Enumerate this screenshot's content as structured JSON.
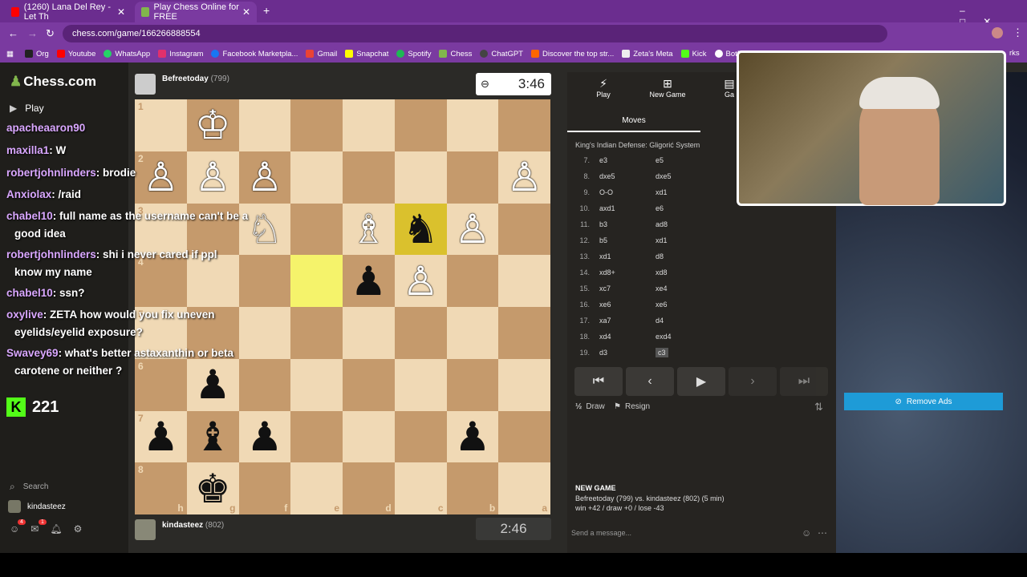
{
  "browser": {
    "tabs": [
      {
        "title": "(1260) Lana Del Rey - Let Th",
        "close": "✕"
      },
      {
        "title": "Play Chess Online for FREE",
        "close": "✕"
      }
    ],
    "new_tab": "+",
    "url": "chess.com/game/166266888554",
    "bookmarks": [
      "Org",
      "Youtube",
      "WhatsApp",
      "Instagram",
      "Facebook Marketpla...",
      "Gmail",
      "Snapchat",
      "Spotify",
      "Chess",
      "ChatGPT",
      "Discover the top str...",
      "Zeta's Meta",
      "Kick",
      "BotRix"
    ],
    "bookmarks_more": "rks"
  },
  "nav": {
    "logo": "Chess.com",
    "play": "Play",
    "search": "Search",
    "username": "kindasteez",
    "badges": [
      "4",
      "1"
    ]
  },
  "top_player": {
    "name": "Befreetoday",
    "rating": "(799)",
    "clock": "3:46"
  },
  "bottom_player": {
    "name": "kindasteez",
    "rating": "(802)",
    "clock": "2:46"
  },
  "board": {
    "ranks": [
      "1",
      "2",
      "3",
      "4",
      "5",
      "6",
      "7",
      "8"
    ],
    "files": [
      "h",
      "g",
      "f",
      "e",
      "d",
      "c",
      "b",
      "a"
    ],
    "squares": [
      [
        "",
        "♔w",
        "",
        "",
        "",
        "",
        "",
        ""
      ],
      [
        "♙w",
        "♙w",
        "♙w",
        "",
        "",
        "",
        "",
        "♙w"
      ],
      [
        "",
        "",
        "♘w",
        "",
        "♗w",
        "♞b",
        "♙w",
        ""
      ],
      [
        "",
        "",
        "",
        "",
        "♟b",
        "♙w",
        "",
        ""
      ],
      [
        "",
        "",
        "",
        "",
        "",
        "",
        "",
        ""
      ],
      [
        "",
        "♟b",
        "",
        "",
        "",
        "",
        "",
        ""
      ],
      [
        "♟b",
        "♝b",
        "♟b",
        "",
        "",
        "",
        "♟b",
        ""
      ],
      [
        "",
        "♚b",
        "",
        "",
        "",
        "",
        "",
        ""
      ]
    ]
  },
  "panel": {
    "tabs": [
      "Play",
      "New Game",
      "Ga"
    ],
    "moves_tab": "Moves",
    "opening": "King's Indian Defense: Gligorić System",
    "moves": [
      {
        "n": "7.",
        "w": "e3",
        "b": "e5"
      },
      {
        "n": "8.",
        "w": "dxe5",
        "b": "dxe5"
      },
      {
        "n": "9.",
        "w": "O-O",
        "b": "xd1"
      },
      {
        "n": "10.",
        "w": "axd1",
        "b": "e6"
      },
      {
        "n": "11.",
        "w": "b3",
        "b": "ad8"
      },
      {
        "n": "12.",
        "w": "b5",
        "b": "xd1"
      },
      {
        "n": "13.",
        "w": "xd1",
        "b": "d8"
      },
      {
        "n": "14.",
        "w": "xd8+",
        "b": "xd8"
      },
      {
        "n": "15.",
        "w": "xc7",
        "b": "xe4"
      },
      {
        "n": "16.",
        "w": "xe6",
        "b": "xe6"
      },
      {
        "n": "17.",
        "w": "xa7",
        "b": "d4"
      },
      {
        "n": "18.",
        "w": "xd4",
        "b": "exd4"
      },
      {
        "n": "19.",
        "w": "d3",
        "b": "c3"
      }
    ],
    "draw": "Draw",
    "resign": "Resign",
    "remove_ads": "Remove Ads",
    "new_game_title": "NEW GAME",
    "new_game_line": "Befreetoday (799) vs. kindasteez (802) (5 min)",
    "new_game_stats": "win +42 / draw +0 / lose -43",
    "message_placeholder": "Send a message..."
  },
  "chat": [
    {
      "user": "apacheaaron90",
      "msg": ""
    },
    {
      "user": "maxilla1",
      "msg": ": W"
    },
    {
      "user": "robertjohnlinders",
      "msg": ": brodie"
    },
    {
      "user": "Anxiolax",
      "msg": ": /raid"
    },
    {
      "user": "chabel10",
      "msg": ": full name as the username can't be a"
    },
    {
      "user": "",
      "msg": "good idea"
    },
    {
      "user": "robertjohnlinders",
      "msg": ": shi i never cared if ppl"
    },
    {
      "user": "",
      "msg": "know my name"
    },
    {
      "user": "chabel10",
      "msg": ": ssn?"
    },
    {
      "user": "oxylive",
      "msg": ": ZETA how would you fix uneven"
    },
    {
      "user": "",
      "msg": "eyelids/eyelid exposure?"
    },
    {
      "user": "Swavey69",
      "msg": ": what's better astaxanthin or beta"
    },
    {
      "user": "",
      "msg": "carotene or neither ?"
    }
  ],
  "viewers": "221"
}
